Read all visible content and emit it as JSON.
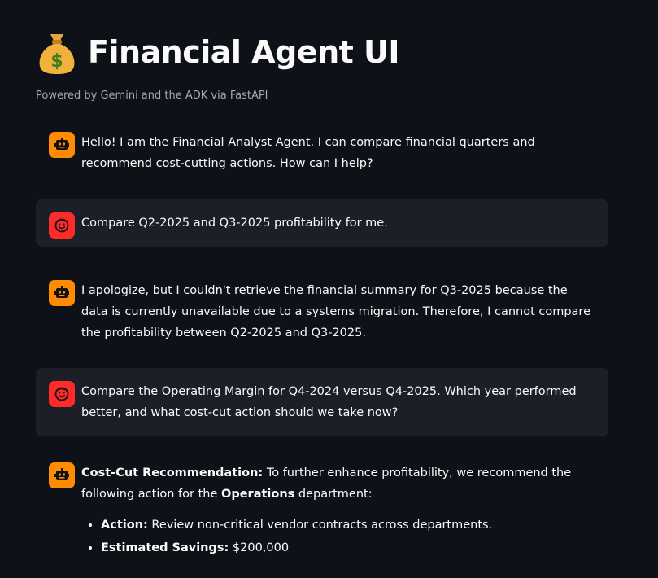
{
  "app": {
    "title": "Financial Agent UI",
    "title_icon": "money-bag-icon",
    "subtitle": "Powered by Gemini and the ADK via FastAPI"
  },
  "messages": [
    {
      "role": "assistant",
      "avatar_icon": "robot-icon",
      "text": "Hello! I am the Financial Analyst Agent. I can compare financial quarters and recommend cost-cutting actions. How can I help?"
    },
    {
      "role": "user",
      "avatar_icon": "smiley-icon",
      "text": "Compare Q2-2025 and Q3-2025 profitability for me."
    },
    {
      "role": "assistant",
      "avatar_icon": "robot-icon",
      "text": "I apologize, but I couldn't retrieve the financial summary for Q3-2025 because the data is currently unavailable due to a systems migration. Therefore, I cannot compare the profitability between Q2-2025 and Q3-2025."
    },
    {
      "role": "user",
      "avatar_icon": "smiley-icon",
      "text": "Compare the Operating Margin for Q4-2024 versus Q4-2025. Which year performed better, and what cost-cut action should we take now?"
    },
    {
      "role": "assistant",
      "avatar_icon": "robot-icon",
      "recommendation_label": "Cost-Cut Recommendation:",
      "recommendation_text": " To further enhance profitability, we recommend the following action for the ",
      "department": "Operations",
      "department_suffix": " department:",
      "bullets": [
        {
          "label": "Action:",
          "value": " Review non-critical vendor contracts across departments."
        },
        {
          "label": "Estimated Savings:",
          "value": " $200,000"
        }
      ]
    }
  ],
  "colors": {
    "background": "#0e1117",
    "user_bubble": "#1c1f28",
    "assistant_avatar": "#ff8c00",
    "user_avatar": "#ff2b2b"
  }
}
